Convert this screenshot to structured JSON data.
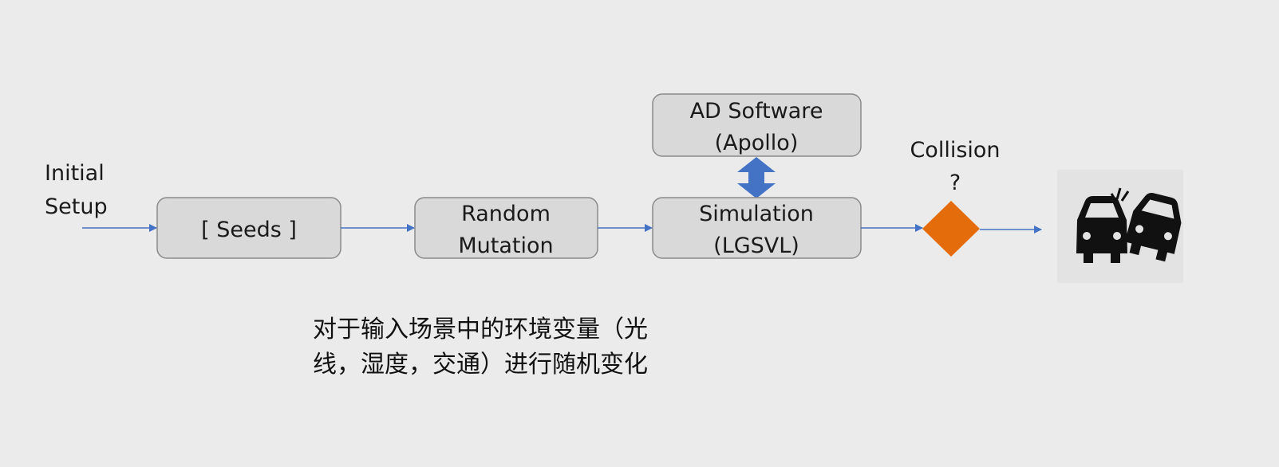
{
  "inputs": {
    "line1": "Initial",
    "line2": "Setup"
  },
  "nodes": {
    "seeds": {
      "line1": "[ Seeds ]"
    },
    "mutation": {
      "line1": "Random",
      "line2": "Mutation"
    },
    "simulation": {
      "line1": "Simulation",
      "line2": "(LGSVL)"
    },
    "ad_software": {
      "line1": "AD Software",
      "line2": "(Apollo)"
    },
    "decision": {
      "line1": "Collision",
      "line2": "?"
    }
  },
  "outcome_icon": "car-crash-icon",
  "colors": {
    "arrow": "#4472c4",
    "decision": "#e46c0a",
    "box_fill": "#d9d9d9",
    "box_stroke": "#8a8a8a"
  },
  "caption": {
    "line1": "对于输入场景中的环境变量（光",
    "line2": "线，湿度，交通）进行随机变化"
  }
}
